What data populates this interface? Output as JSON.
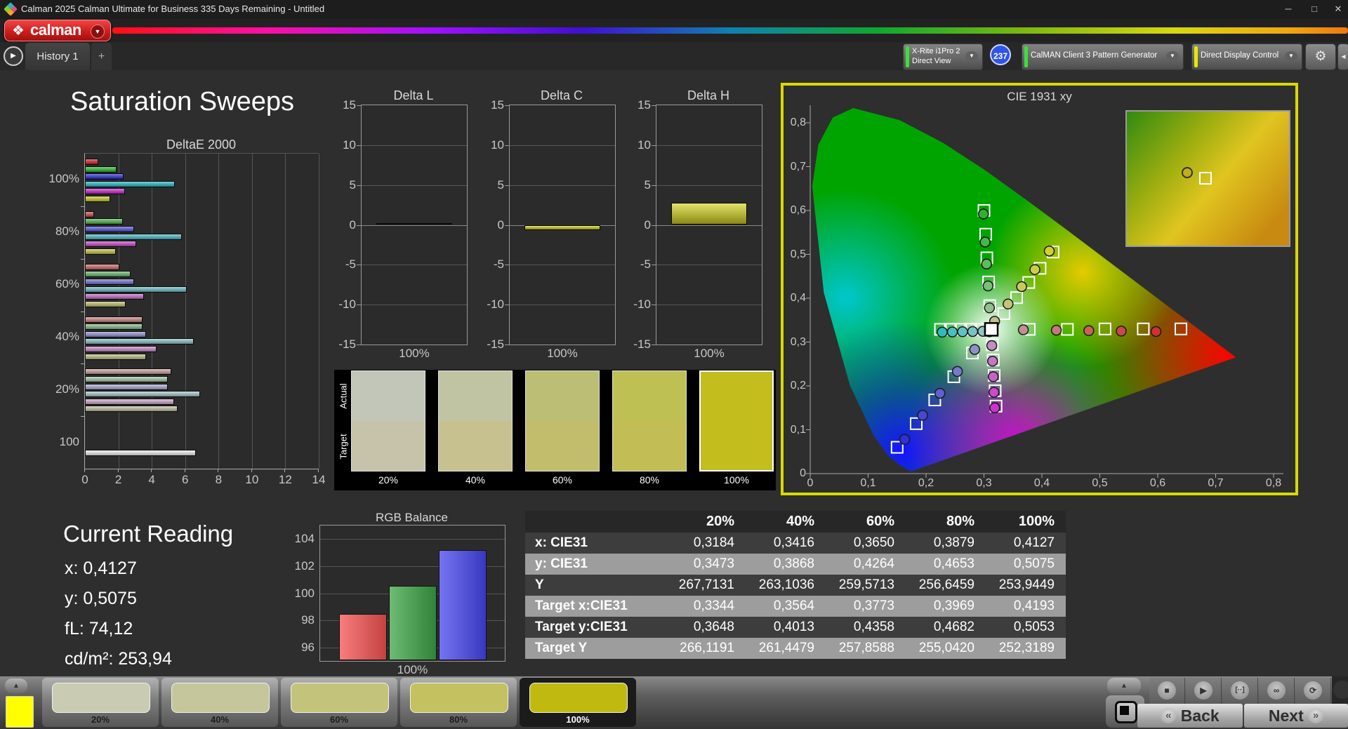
{
  "window": {
    "title": "Calman 2025 Calman Ultimate for Business 335 Days Remaining  - Untitled",
    "minimize": "─",
    "maximize": "□",
    "close": "✕"
  },
  "brand": {
    "logo_text": "calman"
  },
  "tabs": {
    "history": "History 1",
    "add": "+"
  },
  "toolbar": {
    "meter_line1": "X-Rite i1Pro 2",
    "meter_line2": "Direct View",
    "meter_color": "#3ddf3d",
    "badge": "237",
    "pattern_generator": "CalMAN Client 3 Pattern Generator",
    "pattern_color": "#3ddf3d",
    "display_control": "Direct Display Control",
    "display_color": "#e8e800"
  },
  "page_title": "Saturation Sweeps",
  "deltae_chart": {
    "title": "DeltaE 2000",
    "x_ticks": [
      "0",
      "2",
      "4",
      "6",
      "8",
      "10",
      "12",
      "14"
    ],
    "x_max": 14,
    "groups": [
      {
        "label": "100%",
        "values": [
          0.8,
          1.9,
          2.3,
          5.4,
          2.4,
          1.5
        ],
        "colors": [
          "#d11d1d",
          "#26b526",
          "#2525d8",
          "#1fb5c4",
          "#c91fc9",
          "#c9c91f"
        ]
      },
      {
        "label": "80%",
        "values": [
          0.55,
          2.25,
          2.95,
          5.8,
          3.05,
          1.85
        ],
        "colors": [
          "#cf4444",
          "#48b348",
          "#4d4dd2",
          "#46b7c2",
          "#c546c5",
          "#c2c246"
        ]
      },
      {
        "label": "60%",
        "values": [
          2.05,
          2.75,
          2.95,
          6.1,
          3.55,
          2.45
        ],
        "colors": [
          "#cc6363",
          "#66b566",
          "#6f6fcf",
          "#68bac2",
          "#c468c4",
          "#bdbd68"
        ]
      },
      {
        "label": "40%",
        "values": [
          3.45,
          3.45,
          3.65,
          6.5,
          4.3,
          3.65
        ],
        "colors": [
          "#cb8181",
          "#86bb86",
          "#8e8ed1",
          "#88c0c4",
          "#c687c6",
          "#bebe85"
        ]
      },
      {
        "label": "20%",
        "values": [
          5.15,
          4.95,
          4.95,
          6.9,
          5.35,
          5.55
        ],
        "colors": [
          "#c99d9d",
          "#a3c3a3",
          "#a7a7d4",
          "#a5c7ca",
          "#caa5ca",
          "#c2c2a0"
        ]
      },
      {
        "label": "100",
        "values": [
          6.65
        ],
        "colors": [
          "#f0f0f0"
        ]
      }
    ]
  },
  "delta_y_ticks": [
    "15",
    "10",
    "5",
    "0",
    "-5",
    "-10",
    "-15"
  ],
  "delta_charts": [
    {
      "title": "Delta L",
      "value": 0.2,
      "xlabel": "100%",
      "color": "#8f8f35"
    },
    {
      "title": "Delta C",
      "value": -0.65,
      "xlabel": "100%",
      "color": "#d4d41c"
    },
    {
      "title": "Delta H",
      "value": 2.8,
      "xlabel": "100%",
      "color": "#d4d41c"
    }
  ],
  "swatch_strip": {
    "row_labels": [
      "Actual",
      "Target"
    ],
    "items": [
      {
        "label": "20%",
        "actual": "#c2c6b8",
        "target": "#c7c3ab",
        "selected": false
      },
      {
        "label": "40%",
        "actual": "#c1c4a3",
        "target": "#c6c18e",
        "selected": false
      },
      {
        "label": "60%",
        "actual": "#bcbe75",
        "target": "#c2bd6c",
        "selected": false
      },
      {
        "label": "80%",
        "actual": "#bfc054",
        "target": "#c2bd55",
        "selected": false
      },
      {
        "label": "100%",
        "actual": "#c3bd1e",
        "target": "#c3bd1e",
        "selected": true
      }
    ]
  },
  "cie_chart": {
    "title": "CIE 1931 xy",
    "x_ticks": [
      "0",
      "0,1",
      "0,2",
      "0,3",
      "0,4",
      "0,5",
      "0,6",
      "0,7",
      "0,8"
    ],
    "y_ticks": [
      "0,8",
      "0,7",
      "0,6",
      "0,5",
      "0,4",
      "0,3",
      "0,2",
      "0,1",
      "0"
    ],
    "white_point": [
      0.3127,
      0.329
    ],
    "locus": [
      [
        0.1741,
        0.005
      ],
      [
        0.1566,
        0.0177
      ],
      [
        0.1355,
        0.0399
      ],
      [
        0.1096,
        0.0868
      ],
      [
        0.0687,
        0.2007
      ],
      [
        0.0235,
        0.4127
      ],
      [
        0.0034,
        0.6548
      ],
      [
        0.0139,
        0.7502
      ],
      [
        0.0389,
        0.812
      ],
      [
        0.0743,
        0.8338
      ],
      [
        0.1547,
        0.8059
      ],
      [
        0.2296,
        0.7543
      ],
      [
        0.3016,
        0.6923
      ],
      [
        0.3731,
        0.6245
      ],
      [
        0.4441,
        0.5547
      ],
      [
        0.5125,
        0.4866
      ],
      [
        0.5752,
        0.4242
      ],
      [
        0.627,
        0.3725
      ],
      [
        0.6658,
        0.334
      ],
      [
        0.7079,
        0.292
      ],
      [
        0.7347,
        0.2653
      ]
    ],
    "sweeps": [
      {
        "name": "red",
        "targets": [
          [
            0.378,
            0.329
          ],
          [
            0.444,
            0.329
          ],
          [
            0.509,
            0.33
          ],
          [
            0.575,
            0.33
          ],
          [
            0.64,
            0.33
          ]
        ],
        "measured": [
          [
            0.368,
            0.328
          ],
          [
            0.425,
            0.327
          ],
          [
            0.481,
            0.326
          ],
          [
            0.537,
            0.325
          ],
          [
            0.597,
            0.324
          ]
        ],
        "point_colors": [
          "#c09090",
          "#c57878",
          "#c86060",
          "#cc4848",
          "#d03030"
        ]
      },
      {
        "name": "green",
        "targets": [
          [
            0.31,
            0.383
          ],
          [
            0.308,
            0.437
          ],
          [
            0.305,
            0.492
          ],
          [
            0.303,
            0.546
          ],
          [
            0.3,
            0.6
          ]
        ],
        "measured": [
          [
            0.3095,
            0.378
          ],
          [
            0.307,
            0.428
          ],
          [
            0.3045,
            0.478
          ],
          [
            0.302,
            0.528
          ],
          [
            0.299,
            0.592
          ]
        ],
        "point_colors": [
          "#90c090",
          "#78c078",
          "#60bb60",
          "#48b648",
          "#30b030"
        ]
      },
      {
        "name": "blue",
        "targets": [
          [
            0.28,
            0.275
          ],
          [
            0.248,
            0.221
          ],
          [
            0.215,
            0.168
          ],
          [
            0.183,
            0.114
          ],
          [
            0.15,
            0.06
          ]
        ],
        "measured": [
          [
            0.284,
            0.283
          ],
          [
            0.254,
            0.233
          ],
          [
            0.224,
            0.183
          ],
          [
            0.194,
            0.133
          ],
          [
            0.163,
            0.078
          ]
        ],
        "point_colors": [
          "#9090c8",
          "#7878cc",
          "#6060d0",
          "#4848d4",
          "#3030d8"
        ]
      },
      {
        "name": "cyan",
        "targets": [
          [
            0.295,
            0.329
          ],
          [
            0.277,
            0.329
          ],
          [
            0.26,
            0.329
          ],
          [
            0.242,
            0.329
          ],
          [
            0.225,
            0.329
          ]
        ],
        "measured": [
          [
            0.298,
            0.3245
          ],
          [
            0.2805,
            0.324
          ],
          [
            0.263,
            0.3235
          ],
          [
            0.2455,
            0.323
          ],
          [
            0.228,
            0.3225
          ]
        ],
        "point_colors": [
          "#90c4c4",
          "#78c4c4",
          "#60c4c4",
          "#48c0c0",
          "#30bcbc"
        ]
      },
      {
        "name": "magenta",
        "targets": [
          [
            0.3143,
            0.294
          ],
          [
            0.316,
            0.259
          ],
          [
            0.3176,
            0.224
          ],
          [
            0.3193,
            0.189
          ],
          [
            0.3209,
            0.154
          ]
        ],
        "measured": [
          [
            0.3135,
            0.292
          ],
          [
            0.3148,
            0.2565
          ],
          [
            0.316,
            0.221
          ],
          [
            0.3172,
            0.1855
          ],
          [
            0.3185,
            0.15
          ]
        ],
        "point_colors": [
          "#c090c0",
          "#c478c4",
          "#c860c8",
          "#cc48cc",
          "#d030d0"
        ]
      },
      {
        "name": "yellow",
        "targets": [
          [
            0.3344,
            0.3648
          ],
          [
            0.3564,
            0.4013
          ],
          [
            0.3773,
            0.4358
          ],
          [
            0.3969,
            0.4682
          ],
          [
            0.4193,
            0.5053
          ]
        ],
        "measured": [
          [
            0.3184,
            0.3473
          ],
          [
            0.3416,
            0.3868
          ],
          [
            0.365,
            0.4264
          ],
          [
            0.3879,
            0.4653
          ],
          [
            0.4127,
            0.5075
          ]
        ],
        "point_colors": [
          "#c0c090",
          "#c4c478",
          "#c8c860",
          "#cccc48",
          "#d0d030"
        ]
      }
    ],
    "white_measured": [
      0.3095,
      0.3235
    ]
  },
  "current_reading": {
    "title": "Current Reading",
    "x": "x: 0,4127",
    "y": "y: 0,5075",
    "fl": "fL: 74,12",
    "cd": "cd/m²: 253,94"
  },
  "rgb_balance": {
    "title": "RGB Balance",
    "xlabel": "100%",
    "y_ticks": [
      "104",
      "102",
      "100",
      "98",
      "96"
    ],
    "ymin": 95,
    "ymax": 105,
    "bars": [
      {
        "name": "red",
        "value": 98.45,
        "color": "#f65252"
      },
      {
        "name": "green",
        "value": 100.55,
        "color": "#3da446"
      },
      {
        "name": "blue",
        "value": 103.2,
        "color": "#4646ef"
      }
    ]
  },
  "table": {
    "columns": [
      "20%",
      "40%",
      "60%",
      "80%",
      "100%"
    ],
    "rows": [
      {
        "label": "x: CIE31",
        "shade": "dark",
        "values": [
          "0,3184",
          "0,3416",
          "0,3650",
          "0,3879",
          "0,4127"
        ]
      },
      {
        "label": "y: CIE31",
        "shade": "light",
        "values": [
          "0,3473",
          "0,3868",
          "0,4264",
          "0,4653",
          "0,5075"
        ]
      },
      {
        "label": "Y",
        "shade": "dark",
        "values": [
          "267,7131",
          "263,1036",
          "259,5713",
          "256,6459",
          "253,9449"
        ]
      },
      {
        "label": "Target x:CIE31",
        "shade": "light",
        "values": [
          "0,3344",
          "0,3564",
          "0,3773",
          "0,3969",
          "0,4193"
        ]
      },
      {
        "label": "Target y:CIE31",
        "shade": "dark",
        "values": [
          "0,3648",
          "0,4013",
          "0,4358",
          "0,4682",
          "0,5053"
        ]
      },
      {
        "label": "Target Y",
        "shade": "light",
        "values": [
          "266,1191",
          "261,4479",
          "257,8588",
          "255,0420",
          "252,3189"
        ]
      }
    ],
    "shade_dark": "#3d3d3d",
    "shade_light": "#9d9d9d"
  },
  "bottom_bar": {
    "current_patch_color": "#ffff00",
    "patches": [
      {
        "label": "20%",
        "color": "#c9cbb3",
        "selected": false
      },
      {
        "label": "40%",
        "color": "#c5c69c",
        "selected": false
      },
      {
        "label": "60%",
        "color": "#c4c37c",
        "selected": false
      },
      {
        "label": "80%",
        "color": "#c3c160",
        "selected": false
      },
      {
        "label": "100%",
        "color": "#c0ba10",
        "selected": true
      }
    ],
    "transport": [
      "■",
      "▶",
      "[··]",
      "∞",
      "⟳"
    ],
    "back_label": "Back",
    "next_label": "Next"
  }
}
